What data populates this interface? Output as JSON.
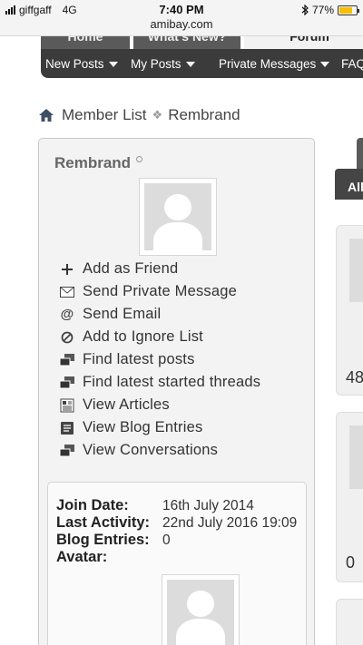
{
  "status_bar": {
    "carrier": "giffgaff",
    "network": "4G",
    "time": "7:40 PM",
    "url": "amibay.com",
    "battery_percent": "77%",
    "battery_level": 0.77,
    "bluetooth_icon": "bluetooth-icon"
  },
  "site_tabs": [
    "Home",
    "What's New?",
    "Forum"
  ],
  "navbar": {
    "items": [
      "New Posts",
      "My Posts",
      "Private Messages",
      "FAQ"
    ]
  },
  "breadcrumb": {
    "home_icon": "home-icon",
    "items": [
      "Member List",
      "Rembrand"
    ]
  },
  "profile": {
    "username": "Rembrand",
    "actions": [
      {
        "icon": "plus-icon",
        "label": "Add as Friend"
      },
      {
        "icon": "envelope-icon",
        "label": "Send Private Message"
      },
      {
        "icon": "at-sign-icon",
        "label": "Send Email"
      },
      {
        "icon": "block-icon",
        "label": "Add to Ignore List"
      },
      {
        "icon": "posts-icon",
        "label": "Find latest posts"
      },
      {
        "icon": "threads-icon",
        "label": "Find latest started threads"
      },
      {
        "icon": "articles-icon",
        "label": "View Articles"
      },
      {
        "icon": "blog-icon",
        "label": "View Blog Entries"
      },
      {
        "icon": "conversations-icon",
        "label": "View Conversations"
      }
    ],
    "info": {
      "join_date_label": "Join Date:",
      "join_date": "16th July 2014",
      "last_activity_label": "Last Activity:",
      "last_activity": "22nd July 2016 19:09",
      "blog_entries_label": "Blog Entries:",
      "blog_entries": "0",
      "avatar_label": "Avatar:"
    }
  },
  "right_column": {
    "tab_label": "All",
    "numbers": [
      "48",
      "0"
    ]
  }
}
